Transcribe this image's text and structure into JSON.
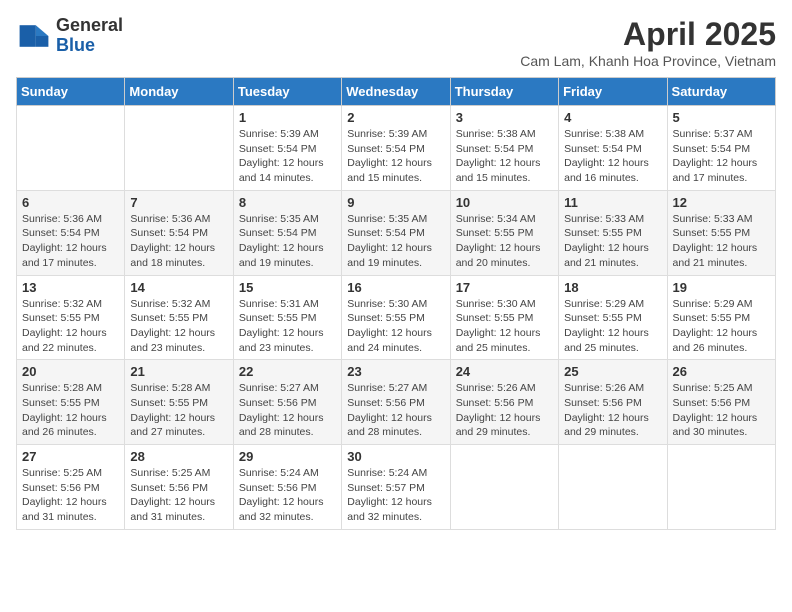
{
  "header": {
    "logo_line1": "General",
    "logo_line2": "Blue",
    "month_year": "April 2025",
    "location": "Cam Lam, Khanh Hoa Province, Vietnam"
  },
  "weekdays": [
    "Sunday",
    "Monday",
    "Tuesday",
    "Wednesday",
    "Thursday",
    "Friday",
    "Saturday"
  ],
  "weeks": [
    [
      {
        "day": "",
        "info": ""
      },
      {
        "day": "",
        "info": ""
      },
      {
        "day": "1",
        "info": "Sunrise: 5:39 AM\nSunset: 5:54 PM\nDaylight: 12 hours and 14 minutes."
      },
      {
        "day": "2",
        "info": "Sunrise: 5:39 AM\nSunset: 5:54 PM\nDaylight: 12 hours and 15 minutes."
      },
      {
        "day": "3",
        "info": "Sunrise: 5:38 AM\nSunset: 5:54 PM\nDaylight: 12 hours and 15 minutes."
      },
      {
        "day": "4",
        "info": "Sunrise: 5:38 AM\nSunset: 5:54 PM\nDaylight: 12 hours and 16 minutes."
      },
      {
        "day": "5",
        "info": "Sunrise: 5:37 AM\nSunset: 5:54 PM\nDaylight: 12 hours and 17 minutes."
      }
    ],
    [
      {
        "day": "6",
        "info": "Sunrise: 5:36 AM\nSunset: 5:54 PM\nDaylight: 12 hours and 17 minutes."
      },
      {
        "day": "7",
        "info": "Sunrise: 5:36 AM\nSunset: 5:54 PM\nDaylight: 12 hours and 18 minutes."
      },
      {
        "day": "8",
        "info": "Sunrise: 5:35 AM\nSunset: 5:54 PM\nDaylight: 12 hours and 19 minutes."
      },
      {
        "day": "9",
        "info": "Sunrise: 5:35 AM\nSunset: 5:54 PM\nDaylight: 12 hours and 19 minutes."
      },
      {
        "day": "10",
        "info": "Sunrise: 5:34 AM\nSunset: 5:55 PM\nDaylight: 12 hours and 20 minutes."
      },
      {
        "day": "11",
        "info": "Sunrise: 5:33 AM\nSunset: 5:55 PM\nDaylight: 12 hours and 21 minutes."
      },
      {
        "day": "12",
        "info": "Sunrise: 5:33 AM\nSunset: 5:55 PM\nDaylight: 12 hours and 21 minutes."
      }
    ],
    [
      {
        "day": "13",
        "info": "Sunrise: 5:32 AM\nSunset: 5:55 PM\nDaylight: 12 hours and 22 minutes."
      },
      {
        "day": "14",
        "info": "Sunrise: 5:32 AM\nSunset: 5:55 PM\nDaylight: 12 hours and 23 minutes."
      },
      {
        "day": "15",
        "info": "Sunrise: 5:31 AM\nSunset: 5:55 PM\nDaylight: 12 hours and 23 minutes."
      },
      {
        "day": "16",
        "info": "Sunrise: 5:30 AM\nSunset: 5:55 PM\nDaylight: 12 hours and 24 minutes."
      },
      {
        "day": "17",
        "info": "Sunrise: 5:30 AM\nSunset: 5:55 PM\nDaylight: 12 hours and 25 minutes."
      },
      {
        "day": "18",
        "info": "Sunrise: 5:29 AM\nSunset: 5:55 PM\nDaylight: 12 hours and 25 minutes."
      },
      {
        "day": "19",
        "info": "Sunrise: 5:29 AM\nSunset: 5:55 PM\nDaylight: 12 hours and 26 minutes."
      }
    ],
    [
      {
        "day": "20",
        "info": "Sunrise: 5:28 AM\nSunset: 5:55 PM\nDaylight: 12 hours and 26 minutes."
      },
      {
        "day": "21",
        "info": "Sunrise: 5:28 AM\nSunset: 5:55 PM\nDaylight: 12 hours and 27 minutes."
      },
      {
        "day": "22",
        "info": "Sunrise: 5:27 AM\nSunset: 5:56 PM\nDaylight: 12 hours and 28 minutes."
      },
      {
        "day": "23",
        "info": "Sunrise: 5:27 AM\nSunset: 5:56 PM\nDaylight: 12 hours and 28 minutes."
      },
      {
        "day": "24",
        "info": "Sunrise: 5:26 AM\nSunset: 5:56 PM\nDaylight: 12 hours and 29 minutes."
      },
      {
        "day": "25",
        "info": "Sunrise: 5:26 AM\nSunset: 5:56 PM\nDaylight: 12 hours and 29 minutes."
      },
      {
        "day": "26",
        "info": "Sunrise: 5:25 AM\nSunset: 5:56 PM\nDaylight: 12 hours and 30 minutes."
      }
    ],
    [
      {
        "day": "27",
        "info": "Sunrise: 5:25 AM\nSunset: 5:56 PM\nDaylight: 12 hours and 31 minutes."
      },
      {
        "day": "28",
        "info": "Sunrise: 5:25 AM\nSunset: 5:56 PM\nDaylight: 12 hours and 31 minutes."
      },
      {
        "day": "29",
        "info": "Sunrise: 5:24 AM\nSunset: 5:56 PM\nDaylight: 12 hours and 32 minutes."
      },
      {
        "day": "30",
        "info": "Sunrise: 5:24 AM\nSunset: 5:57 PM\nDaylight: 12 hours and 32 minutes."
      },
      {
        "day": "",
        "info": ""
      },
      {
        "day": "",
        "info": ""
      },
      {
        "day": "",
        "info": ""
      }
    ]
  ]
}
